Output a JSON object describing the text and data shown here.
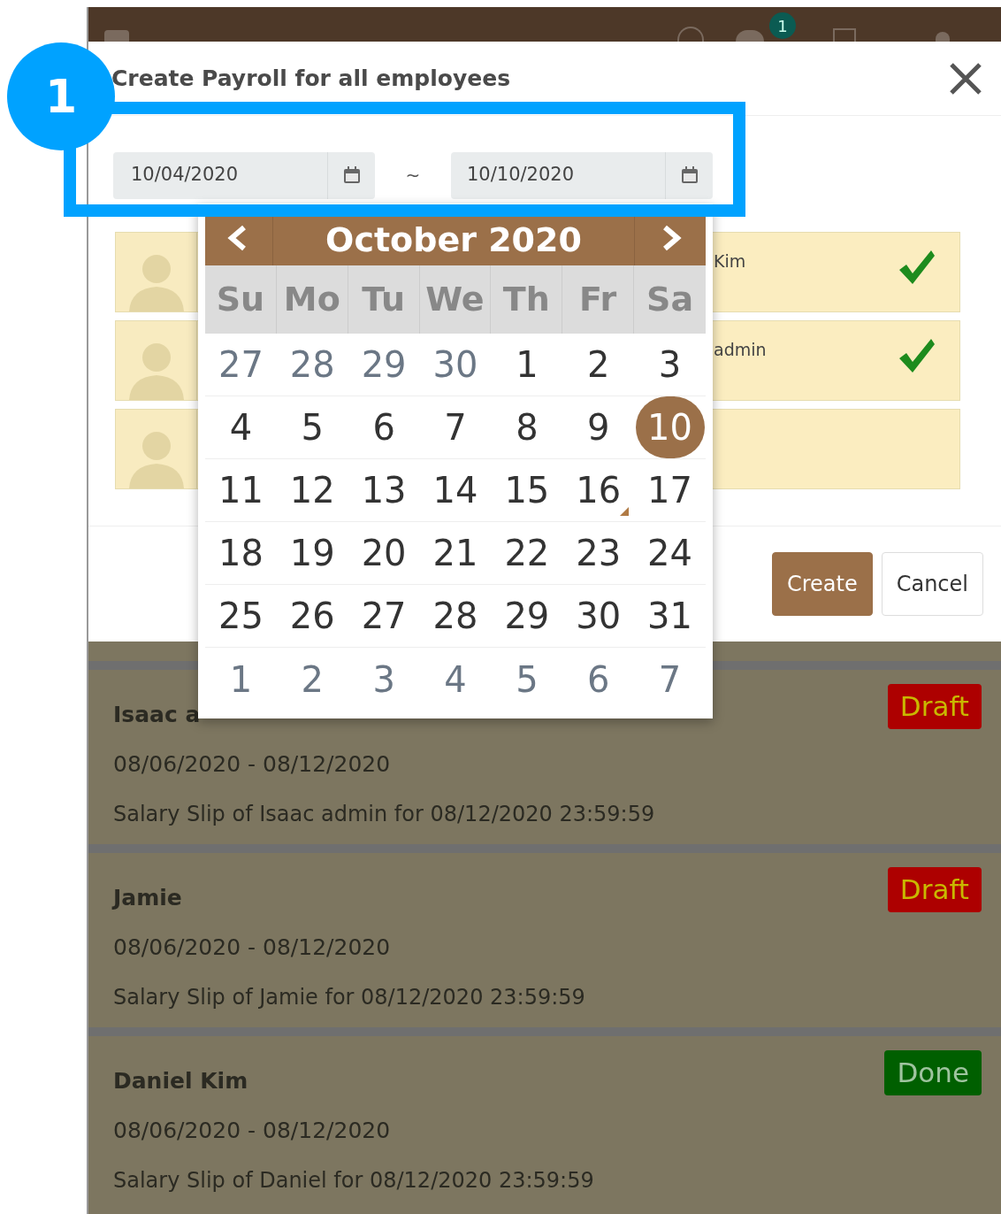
{
  "topbar": {
    "notification_count": "1"
  },
  "callout": {
    "number": "1"
  },
  "modal": {
    "title": "Create Payroll for all employees",
    "date_from": "10/04/2020",
    "separator": "~",
    "date_to": "10/10/2020",
    "employees": [
      {
        "name": "Kim",
        "checked": true
      },
      {
        "name": "admin",
        "checked": true
      },
      {
        "checked": false
      }
    ],
    "buttons": [
      {
        "label": "Create",
        "kind": "primary"
      },
      {
        "label": "Cancel",
        "kind": "secondary"
      }
    ]
  },
  "calendar": {
    "month": "October 2020",
    "weekdays": [
      "Su",
      "Mo",
      "Tu",
      "We",
      "Th",
      "Fr",
      "Sa"
    ],
    "weeks": [
      [
        {
          "label": "27",
          "outside": true,
          "selected": false
        },
        {
          "label": "28",
          "outside": true,
          "selected": false
        },
        {
          "label": "29",
          "outside": true,
          "selected": false
        },
        {
          "label": "30",
          "outside": true,
          "selected": false
        },
        {
          "label": "1",
          "outside": false,
          "selected": false
        },
        {
          "label": "2",
          "outside": false,
          "selected": false
        },
        {
          "label": "3",
          "outside": false,
          "selected": false
        }
      ],
      [
        {
          "label": "4",
          "outside": false,
          "selected": false
        },
        {
          "label": "5",
          "outside": false,
          "selected": false
        },
        {
          "label": "6",
          "outside": false,
          "selected": false
        },
        {
          "label": "7",
          "outside": false,
          "selected": false
        },
        {
          "label": "8",
          "outside": false,
          "selected": false
        },
        {
          "label": "9",
          "outside": false,
          "selected": false
        },
        {
          "label": "10",
          "outside": false,
          "selected": true
        }
      ],
      [
        {
          "label": "11",
          "outside": false,
          "selected": false
        },
        {
          "label": "12",
          "outside": false,
          "selected": false
        },
        {
          "label": "13",
          "outside": false,
          "selected": false
        },
        {
          "label": "14",
          "outside": false,
          "selected": false
        },
        {
          "label": "15",
          "outside": false,
          "selected": false
        },
        {
          "label": "16",
          "outside": false,
          "selected": false,
          "today": true
        },
        {
          "label": "17",
          "outside": false,
          "selected": false
        }
      ],
      [
        {
          "label": "18",
          "outside": false,
          "selected": false
        },
        {
          "label": "19",
          "outside": false,
          "selected": false
        },
        {
          "label": "20",
          "outside": false,
          "selected": false
        },
        {
          "label": "21",
          "outside": false,
          "selected": false
        },
        {
          "label": "22",
          "outside": false,
          "selected": false
        },
        {
          "label": "23",
          "outside": false,
          "selected": false
        },
        {
          "label": "24",
          "outside": false,
          "selected": false
        }
      ],
      [
        {
          "label": "25",
          "outside": false,
          "selected": false
        },
        {
          "label": "26",
          "outside": false,
          "selected": false
        },
        {
          "label": "27",
          "outside": false,
          "selected": false
        },
        {
          "label": "28",
          "outside": false,
          "selected": false
        },
        {
          "label": "29",
          "outside": false,
          "selected": false
        },
        {
          "label": "30",
          "outside": false,
          "selected": false
        },
        {
          "label": "31",
          "outside": false,
          "selected": false
        }
      ],
      [
        {
          "label": "1",
          "outside": true,
          "selected": false
        },
        {
          "label": "2",
          "outside": true,
          "selected": false
        },
        {
          "label": "3",
          "outside": true,
          "selected": false
        },
        {
          "label": "4",
          "outside": true,
          "selected": false
        },
        {
          "label": "5",
          "outside": true,
          "selected": false
        },
        {
          "label": "6",
          "outside": true,
          "selected": false
        },
        {
          "label": "7",
          "outside": true,
          "selected": false
        }
      ]
    ]
  },
  "slips": [
    {
      "name": "Isaac a",
      "period": "08/06/2020 - 08/12/2020",
      "description": "Salary Slip of Isaac admin for 08/12/2020 23:59:59",
      "status": {
        "label": "Draft",
        "kind": "draft"
      }
    },
    {
      "name": "Jamie",
      "period": "08/06/2020 - 08/12/2020",
      "description": "Salary Slip of Jamie for 08/12/2020 23:59:59",
      "status": {
        "label": "Draft",
        "kind": "draft"
      }
    },
    {
      "name": "Daniel Kim",
      "period": "08/06/2020 - 08/12/2020",
      "description": "Salary Slip of Daniel for 08/12/2020 23:59:59",
      "status": {
        "label": "Done",
        "kind": "done"
      }
    }
  ]
}
